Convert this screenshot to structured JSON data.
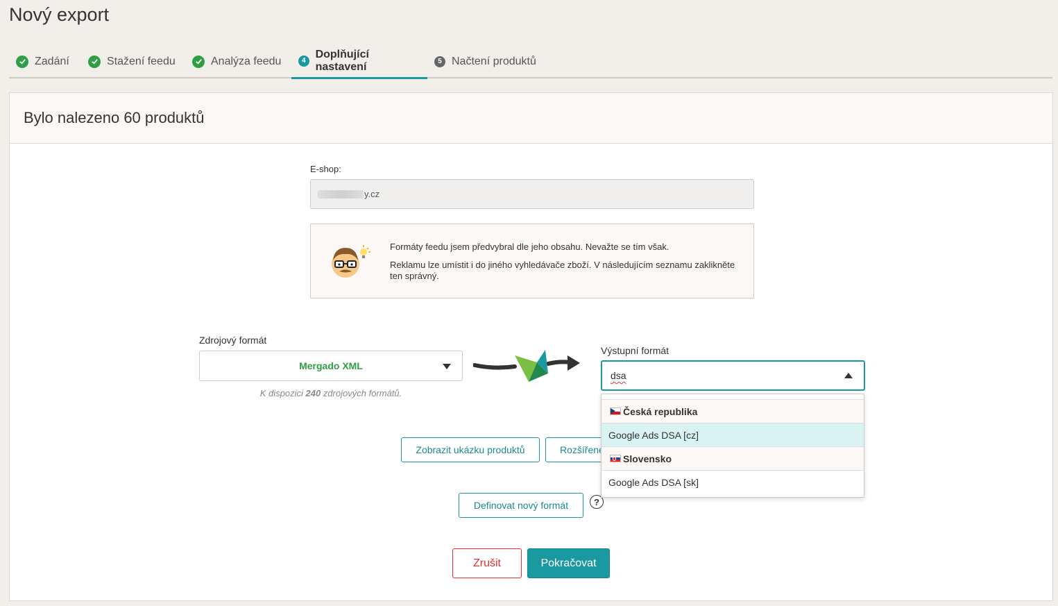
{
  "page": {
    "title": "Nový export"
  },
  "steps": [
    {
      "label": "Zadání",
      "state": "done"
    },
    {
      "label": "Stažení feedu",
      "state": "done"
    },
    {
      "label": "Analýza feedu",
      "state": "done"
    },
    {
      "label": "Doplňující nastavení",
      "state": "current",
      "number": "4"
    },
    {
      "label": "Načtení produktů",
      "state": "todo",
      "number": "5"
    }
  ],
  "card": {
    "title": "Bylo nalezeno 60 produktů",
    "eshop_label": "E-shop:",
    "eshop_value": "y.cz",
    "hint_line1": "Formáty feedu jsem předvybral dle jeho obsahu. Nevažte se tím však.",
    "hint_line2": "Reklamu lze umístit i do jiného vyhledávače zboží. V následujícím seznamu zaklikněte ten správný.",
    "source_label": "Zdrojový formát",
    "source_value": "Mergado XML",
    "source_note_prefix": "K dispozici",
    "source_note_count": "240",
    "source_note_suffix": "zdrojových formátů.",
    "output_label": "Výstupní formát",
    "output_typed": "dsa",
    "btn_preview": "Zobrazit ukázku produktů",
    "btn_advanced": "Rozšířené",
    "btn_define": "Definovat nový formát",
    "help_symbol": "?",
    "btn_cancel": "Zrušit",
    "btn_continue": "Pokračovat"
  },
  "dropdown": {
    "groups": [
      {
        "country": "Česká republika",
        "flag": "cz",
        "items": [
          "Google Ads DSA [cz]"
        ]
      },
      {
        "country": "Slovensko",
        "flag": "sk",
        "items": [
          "Google Ads DSA [sk]"
        ]
      }
    ]
  },
  "colors": {
    "accent": "#1a9aa0",
    "success": "#2f9e44",
    "danger": "#e03131",
    "background": "#f2efea"
  }
}
